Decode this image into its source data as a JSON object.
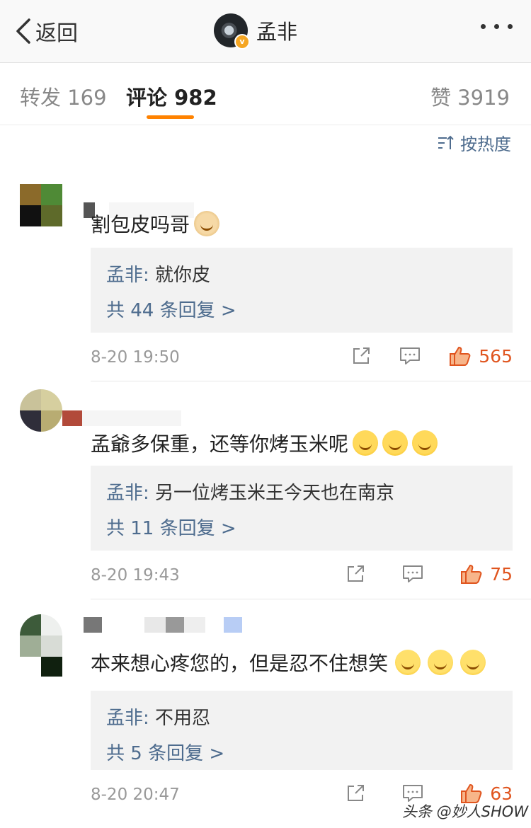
{
  "nav": {
    "back_label": "返回",
    "title": "孟非",
    "verified_badge": "v"
  },
  "tabs": {
    "repost": "转发 169",
    "comment": "评论 982",
    "like": "赞 3919"
  },
  "sort_label": "按热度",
  "comments": [
    {
      "text": "割包皮吗哥",
      "reply_author": "孟非:",
      "reply_text": " 就你皮",
      "reply_count": "共 44 条回复 >",
      "time": "8-20 19:50",
      "likes": "565",
      "emojis": [
        "doge"
      ]
    },
    {
      "text": "孟爺多保重，还等你烤玉米呢",
      "reply_author": "孟非:",
      "reply_text": " 另一位烤玉米王今天也在南京",
      "reply_count": "共 11 条回复 >",
      "time": "8-20 19:43",
      "likes": "75",
      "emojis": [
        "laugh",
        "laugh",
        "laugh"
      ]
    },
    {
      "text": "本来想心疼您的，但是忍不住想笑",
      "reply_author": "孟非:",
      "reply_text": " 不用忍",
      "reply_count": "共 5 条回复 >",
      "time": "8-20 20:47",
      "likes": "63",
      "emojis": [
        "smile",
        "smile",
        "smile"
      ]
    }
  ],
  "watermark": "头条 @妙人SHOW",
  "colors": {
    "accent": "#ff8200",
    "link": "#4e6c8e",
    "like": "#e0551f"
  }
}
